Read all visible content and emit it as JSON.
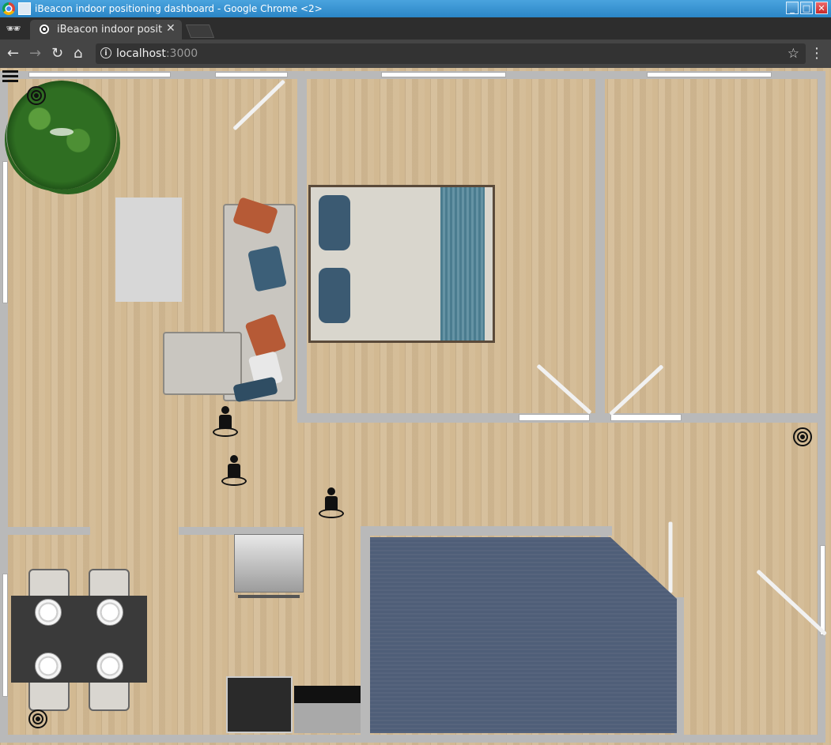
{
  "window": {
    "title": "iBeacon indoor positioning dashboard - Google Chrome <2>",
    "minimize": "_",
    "maximize": "□",
    "close": "✕"
  },
  "tabs": [
    {
      "title": "iBeacon indoor positio",
      "close": "✕"
    }
  ],
  "toolbar": {
    "back": "←",
    "forward": "→",
    "reload": "↻",
    "home": "⌂",
    "info": "i",
    "host": "localhost",
    "port": ":3000",
    "star": "☆",
    "menu": "⋮"
  },
  "icons": {
    "incognito": "🕶",
    "beacon": "beacon-icon",
    "person": "person-icon",
    "menu": "hamburger-icon"
  },
  "colors": {
    "floor": "#d2b992",
    "wall": "#b9b9b9",
    "carpet": "#4f5e78",
    "title_bar": "#2b86c6",
    "marker": "#111111"
  }
}
